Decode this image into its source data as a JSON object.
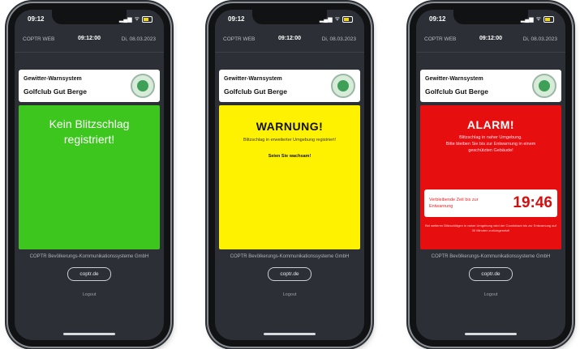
{
  "status": {
    "time": "09:12",
    "signal": "▂▄▆",
    "wifi": "ᯤ"
  },
  "appbar": {
    "left": "COPTR WEB",
    "center": "09:12:00",
    "right": "Di, 08.03.2023"
  },
  "club": {
    "title": "Gewitter-Warnsystem",
    "name": "Golfclub Gut Berge"
  },
  "green": {
    "line1": "Kein Blitzschlag",
    "line2": "registriert!"
  },
  "yellow": {
    "title": "WARNUNG!",
    "body": "Blitzschlag in erweiterter Umgebung registriert!",
    "call": "Seien Sie wachsam!"
  },
  "red": {
    "title": "ALARM!",
    "body1": "Blitzschlag in naher Umgebung.",
    "body2": "Bitte bleiben Sie bis zur Entwarnung in einem",
    "body3": "geschützten Gebäude!",
    "timer_label": "Verbleibende Zeit bis zur Entwarnung",
    "timer_value": "19:46",
    "note": "Bei weiteren Blitzschlägen in naher Umgebung wird der Countdown bis zur Entwarnung auf 30 Minuten zurückgesetzt!"
  },
  "footer": {
    "company": "COPTR Bevölkerungs-Kommunikationssysteme GmbH",
    "site": "coptr.de",
    "logout": "Logout"
  }
}
